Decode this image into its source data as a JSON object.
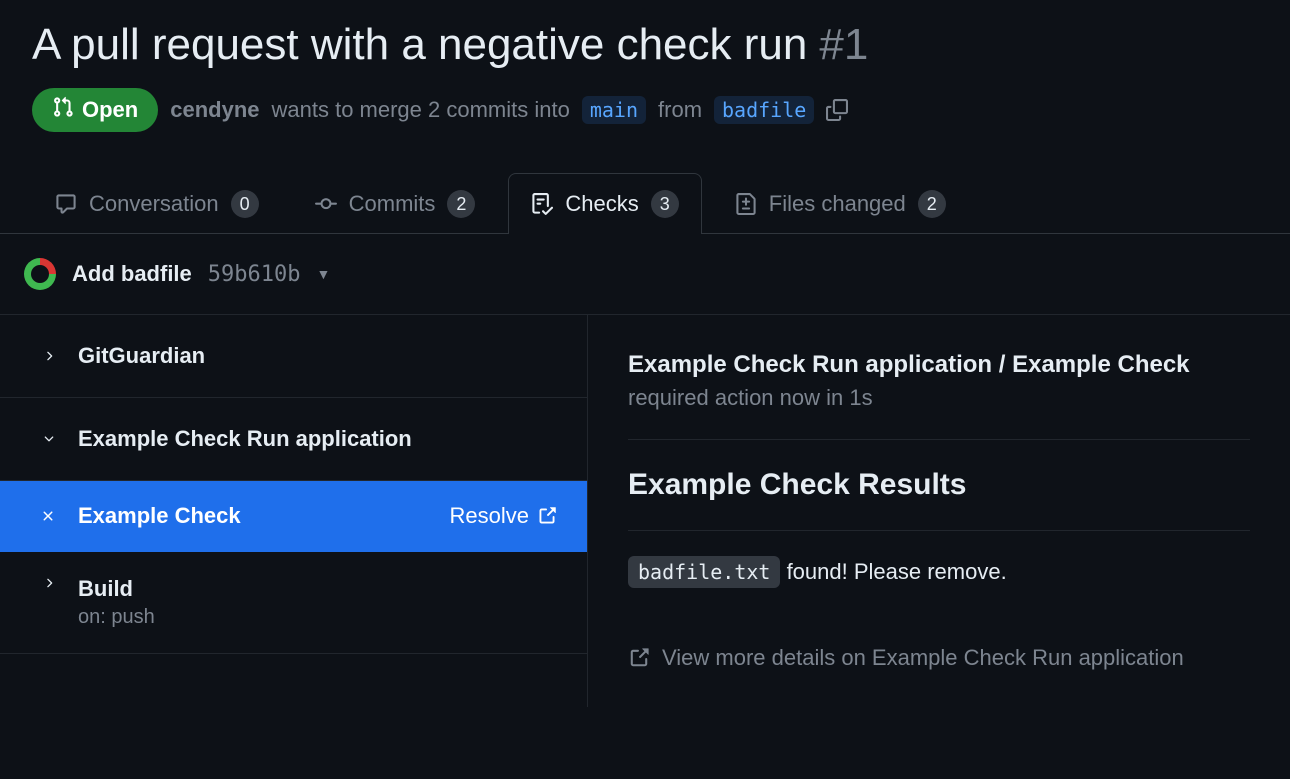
{
  "pr": {
    "title": "A pull request with a negative check run",
    "number": "#1",
    "state": "Open",
    "author": "cendyne",
    "merge_text_1": "wants to merge 2 commits into",
    "base_branch": "main",
    "merge_text_2": "from",
    "head_branch": "badfile"
  },
  "tabs": {
    "conversation": {
      "label": "Conversation",
      "count": "0"
    },
    "commits": {
      "label": "Commits",
      "count": "2"
    },
    "checks": {
      "label": "Checks",
      "count": "3"
    },
    "files": {
      "label": "Files changed",
      "count": "2"
    }
  },
  "commit": {
    "title": "Add badfile",
    "sha": "59b610b"
  },
  "sidebar": {
    "gitguardian": "GitGuardian",
    "example_app": "Example Check Run application",
    "example_check": "Example Check",
    "resolve": "Resolve",
    "build": "Build",
    "build_sub": "on: push"
  },
  "main": {
    "title": "Example Check Run application / Example Check",
    "subtitle": "required action now in 1s",
    "results_heading": "Example Check Results",
    "result_file": "badfile.txt",
    "result_text": " found! Please remove.",
    "view_more": "View more details on Example Check Run application"
  }
}
